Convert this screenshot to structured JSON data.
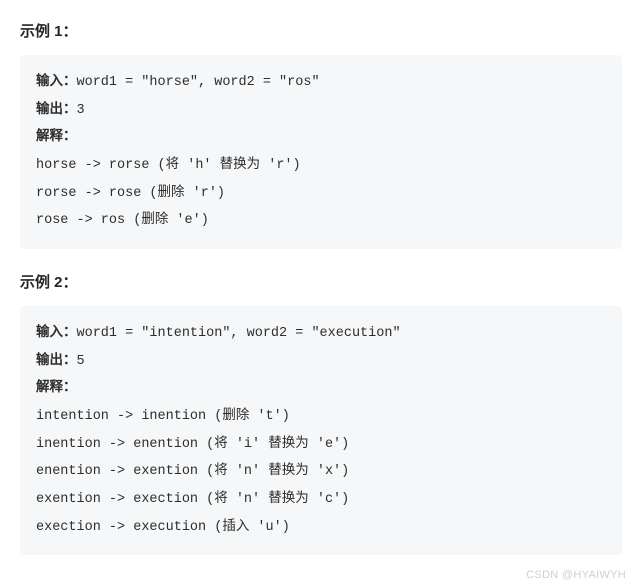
{
  "example1": {
    "title": "示例 1：",
    "input_label": "输入：",
    "input_value": "word1 = \"horse\", word2 = \"ros\"",
    "output_label": "输出：",
    "output_value": "3",
    "explain_label": "解释：",
    "lines": [
      "horse -> rorse (将 'h' 替换为 'r')",
      "rorse -> rose (删除 'r')",
      "rose -> ros (删除 'e')"
    ]
  },
  "example2": {
    "title": "示例 2：",
    "input_label": "输入：",
    "input_value": "word1 = \"intention\", word2 = \"execution\"",
    "output_label": "输出：",
    "output_value": "5",
    "explain_label": "解释：",
    "lines": [
      "intention -> inention (删除 't')",
      "inention -> enention (将 'i' 替换为 'e')",
      "enention -> exention (将 'n' 替换为 'x')",
      "exention -> exection (将 'n' 替换为 'c')",
      "exection -> execution (插入 'u')"
    ]
  },
  "watermark": "CSDN @HYAIWYH"
}
